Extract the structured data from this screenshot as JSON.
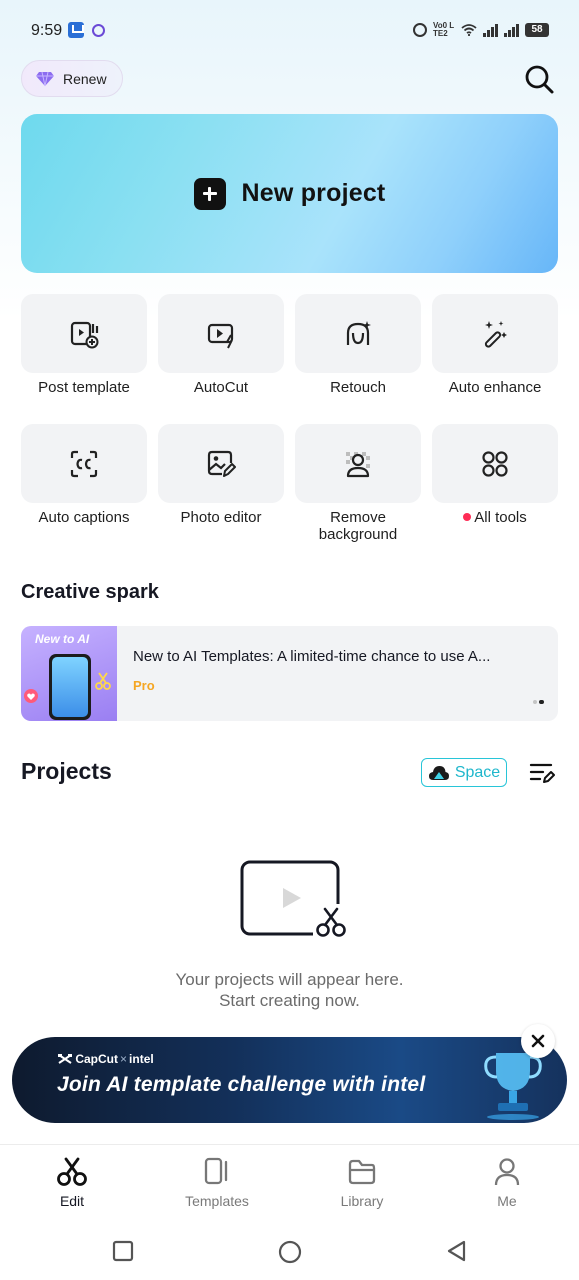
{
  "status_bar": {
    "time": "9:59",
    "volte": "Vo0 LTE2",
    "battery": "58"
  },
  "header": {
    "renew_label": "Renew"
  },
  "new_project": {
    "label": "New project"
  },
  "tools": [
    {
      "label": "Post template",
      "icon": "post-template-icon"
    },
    {
      "label": "AutoCut",
      "icon": "autocut-icon"
    },
    {
      "label": "Retouch",
      "icon": "retouch-icon"
    },
    {
      "label": "Auto enhance",
      "icon": "magic-wand-icon"
    },
    {
      "label": "Auto captions",
      "icon": "captions-icon"
    },
    {
      "label": "Photo editor",
      "icon": "photo-edit-icon"
    },
    {
      "label": "Remove background",
      "icon": "remove-bg-icon"
    },
    {
      "label": "All tools",
      "icon": "grid-icon",
      "badge": "red-dot"
    }
  ],
  "creative_spark": {
    "title": "Creative spark",
    "card": {
      "thumb_title": "New to AI",
      "text": "New to AI Templates: A limited-time chance to use A...",
      "tag": "Pro"
    }
  },
  "projects": {
    "title": "Projects",
    "space_label": "Space",
    "empty_line1": "Your projects will appear here.",
    "empty_line2": "Start creating now."
  },
  "banner": {
    "brand": "CapCut",
    "partner": "intel",
    "title": "Join AI template challenge with intel"
  },
  "bottom_nav": [
    {
      "label": "Edit",
      "active": true
    },
    {
      "label": "Templates",
      "active": false
    },
    {
      "label": "Library",
      "active": false
    },
    {
      "label": "Me",
      "active": false
    }
  ],
  "colors": {
    "accent_cyan": "#1fb7cc",
    "pro_orange": "#f5a623",
    "badge_red": "#fe2c55"
  }
}
